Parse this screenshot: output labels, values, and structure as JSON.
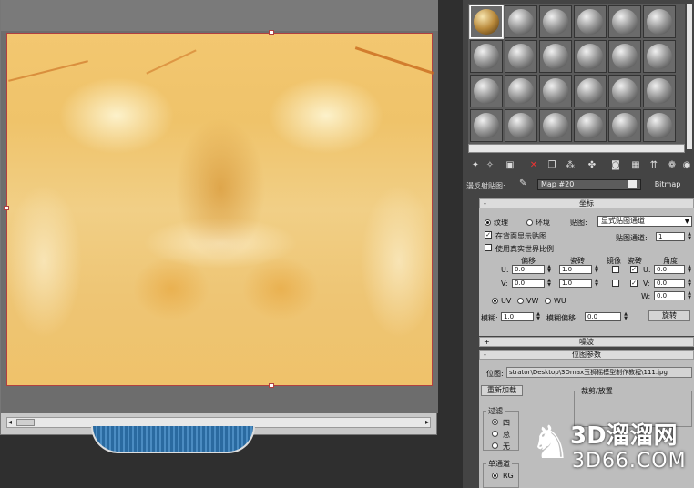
{
  "viewer": {
    "scroll_left": "◂",
    "scroll_right": "▸"
  },
  "material_editor": {
    "toolbar_icons": [
      "get-material-icon",
      "put-to-scene-icon",
      "assign-icon",
      "reset-icon",
      "copy-icon",
      "make-unique-icon",
      "put-library-icon",
      "material-id-icon",
      "show-map-icon",
      "show-end-result-icon",
      "go-parent-icon",
      "go-sibling-icon",
      "background-icon"
    ],
    "map_row": {
      "label": "漫反射贴图:",
      "map_name": "Map #20",
      "map_type": "Bitmap"
    },
    "coordinates": {
      "header": "坐标",
      "texture_label": "纹理",
      "environ_label": "环境",
      "mapping_label": "贴图:",
      "mapping_value": "显式贴图通道",
      "show_back_label": "在背面显示贴图",
      "map_channel_label": "贴图通道:",
      "map_channel_value": "1",
      "real_world_label": "使用真实世界比例",
      "col_offset": "偏移",
      "col_tiling": "瓷砖",
      "col_mirror": "镜像",
      "col_tile": "瓷砖",
      "col_angle": "角度",
      "u_label": "U:",
      "v_label": "V:",
      "w_label": "W:",
      "u_offset": "0.0",
      "v_offset": "0.0",
      "u_tiling": "1.0",
      "v_tiling": "1.0",
      "u_angle": "0.0",
      "v_angle": "0.0",
      "w_angle": "0.0",
      "uv_label": "UV",
      "vw_label": "VW",
      "wu_label": "WU",
      "blur_label": "模糊:",
      "blur_value": "1.0",
      "blur_offset_label": "模糊偏移:",
      "blur_offset_value": "0.0",
      "rotate_button": "旋转"
    },
    "noise": {
      "header": "噪波",
      "pm": "+"
    },
    "bitmap_params": {
      "header": "位图参数",
      "pm": "-",
      "bitmap_label": "位图:",
      "bitmap_path": "strator\\Desktop\\3Dmax玉狮摇模型制作教程\\111.jpg",
      "reload_button": "重新加载",
      "crop_label": "裁剪/放置",
      "filter_label": "过滤",
      "filter_opt1": "四",
      "filter_opt2": "总",
      "filter_opt3": "无",
      "mono_label": "单通道",
      "mono_opt1": "RG"
    },
    "coord_pm": "-"
  },
  "watermark": {
    "line1": "3D溜溜网",
    "line2": "3D66.COM"
  }
}
